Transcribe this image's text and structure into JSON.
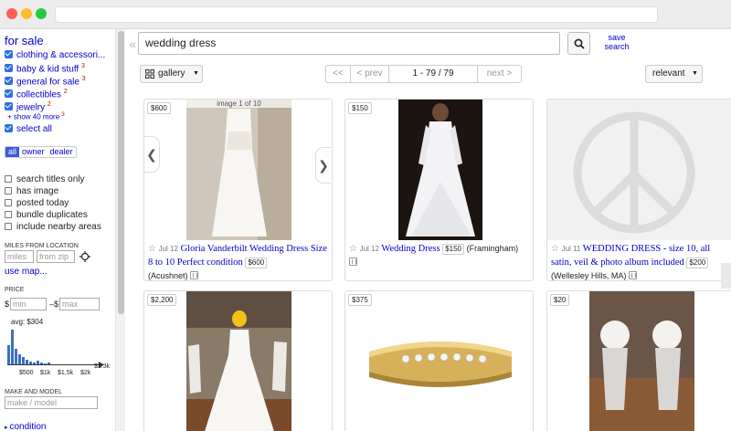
{
  "sidebar": {
    "title": "for sale",
    "categories": [
      {
        "label": "clothing & accessori...",
        "count": ""
      },
      {
        "label": "baby & kid stuff",
        "count": "3"
      },
      {
        "label": "general for sale",
        "count": "3"
      },
      {
        "label": "collectibles",
        "count": "2"
      },
      {
        "label": "jewelry",
        "count": "2"
      }
    ],
    "show_more": "show 40 more",
    "show_more_count": "3",
    "select_all": "select all",
    "seller_tabs": [
      "all",
      "owner",
      "dealer"
    ],
    "options": [
      "search titles only",
      "has image",
      "posted today",
      "bundle duplicates",
      "include nearby areas"
    ],
    "miles_label": "MILES FROM LOCATION",
    "miles_placeholder": "miles",
    "zip_placeholder": "from zip",
    "use_map": "use map...",
    "price_label": "PRICE",
    "currency": "$",
    "min_placeholder": "min",
    "dash": "–",
    "max_placeholder": "max",
    "avg": "avg: $304",
    "hist_ticks": [
      "$500",
      "$1k",
      "$1.5k",
      "$2k"
    ],
    "hist_max": "$3.3k",
    "hist_values": [
      0.55,
      1.0,
      0.45,
      0.3,
      0.2,
      0.12,
      0.08,
      0.05,
      0.1,
      0.04,
      0.03,
      0.05
    ],
    "make_label": "MAKE AND MODEL",
    "make_placeholder": "make / model",
    "condition": "condition"
  },
  "search": {
    "query": "wedding dress",
    "save_label": "save search"
  },
  "toolbar": {
    "view": "gallery",
    "first": "<<",
    "prev": "< prev",
    "range": "1 - 79 / 79",
    "next": "next >",
    "sort": "relevant"
  },
  "listings": [
    {
      "price": "$600",
      "image_caption": "image 1 of 10",
      "star": "☆",
      "date": "Jul 12",
      "title": "Gloria Vanderbilt Wedding Dress Size 8 to 10 Perfect condition",
      "row_price": "$600",
      "location": "(Acushnet)"
    },
    {
      "price": "$150",
      "star": "☆",
      "date": "Jul 12",
      "title": "Wedding Dress",
      "row_price": "$150",
      "location": "(Framingham)"
    },
    {
      "price": "",
      "star": "☆",
      "date": "Jul 11",
      "title": "WEDDING DRESS - size 10, all satin, veil & photo album included",
      "row_price": "$200",
      "location": "(Wellesley Hills, MA)"
    },
    {
      "price": "$2,200"
    },
    {
      "price": "$375"
    },
    {
      "price": "$20"
    }
  ]
}
